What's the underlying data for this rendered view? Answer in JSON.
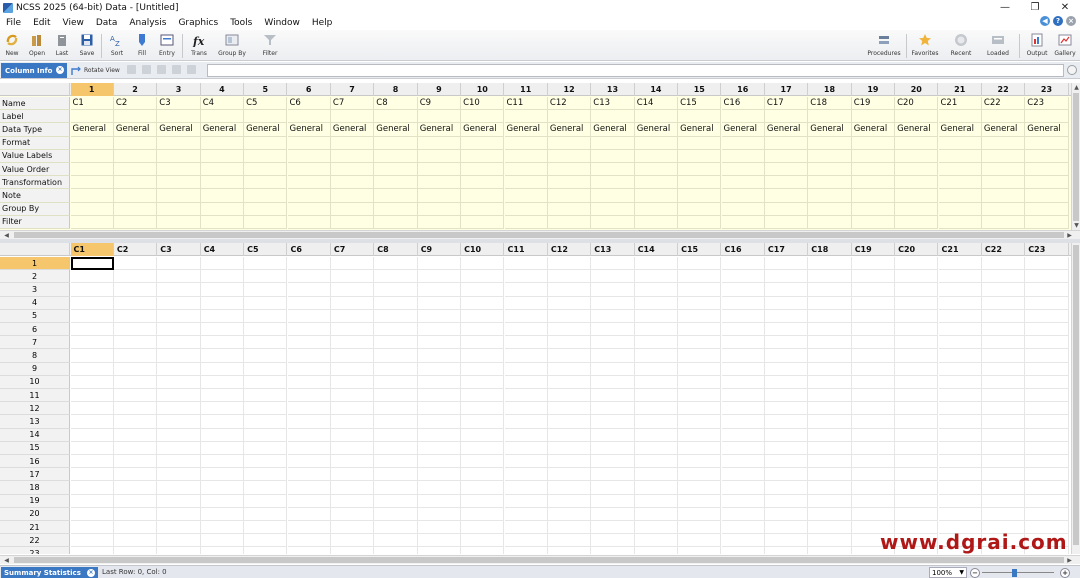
{
  "window": {
    "title": "NCSS 2025 (64-bit) Data - [Untitled]"
  },
  "menu": [
    "File",
    "Edit",
    "View",
    "Data",
    "Analysis",
    "Graphics",
    "Tools",
    "Window",
    "Help"
  ],
  "toolbar": {
    "left": [
      {
        "label": "New",
        "icon": "new-icon"
      },
      {
        "label": "Open",
        "icon": "open-icon"
      },
      {
        "label": "Last",
        "icon": "last-icon"
      },
      {
        "label": "Save",
        "icon": "save-icon"
      },
      {
        "label": "Sort",
        "icon": "sort-icon"
      },
      {
        "label": "Fill",
        "icon": "fill-icon"
      },
      {
        "label": "Entry",
        "icon": "entry-icon"
      },
      {
        "label": "Trans",
        "icon": "function-icon"
      },
      {
        "label": "Group By",
        "icon": "group-by-icon"
      },
      {
        "label": "Filter",
        "icon": "filter-icon"
      }
    ],
    "right": [
      {
        "label": "Procedures",
        "icon": "procedures-icon"
      },
      {
        "label": "Favorites",
        "icon": "star-icon"
      },
      {
        "label": "Recent",
        "icon": "recent-icon"
      },
      {
        "label": "Loaded",
        "icon": "loaded-icon"
      },
      {
        "label": "Output",
        "icon": "output-icon"
      },
      {
        "label": "Gallery",
        "icon": "gallery-icon"
      }
    ]
  },
  "tabs": {
    "active": "Column Info",
    "rotate_view": "Rotate View"
  },
  "column_info": {
    "col_numbers": [
      "1",
      "2",
      "3",
      "4",
      "5",
      "6",
      "7",
      "8",
      "9",
      "10",
      "11",
      "12",
      "13",
      "14",
      "15",
      "16",
      "17",
      "18",
      "19",
      "20",
      "21",
      "22",
      "23"
    ],
    "row_labels": [
      "Name",
      "Label",
      "Data Type",
      "Format",
      "Value Labels",
      "Value Order",
      "Transformation",
      "Note",
      "Group By",
      "Filter"
    ],
    "names": [
      "C1",
      "C2",
      "C3",
      "C4",
      "C5",
      "C6",
      "C7",
      "C8",
      "C9",
      "C10",
      "C11",
      "C12",
      "C13",
      "C14",
      "C15",
      "C16",
      "C17",
      "C18",
      "C19",
      "C20",
      "C21",
      "C22",
      "C23"
    ],
    "data_type": "General"
  },
  "data_grid": {
    "col_headers": [
      "C1",
      "C2",
      "C3",
      "C4",
      "C5",
      "C6",
      "C7",
      "C8",
      "C9",
      "C10",
      "C11",
      "C12",
      "C13",
      "C14",
      "C15",
      "C16",
      "C17",
      "C18",
      "C19",
      "C20",
      "C21",
      "C22",
      "C23"
    ],
    "row_numbers": [
      "1",
      "2",
      "3",
      "4",
      "5",
      "6",
      "7",
      "8",
      "9",
      "10",
      "11",
      "12",
      "13",
      "14",
      "15",
      "16",
      "17",
      "18",
      "19",
      "20",
      "21",
      "22",
      "23"
    ]
  },
  "status": {
    "tab": "Summary Statistics",
    "text": "Last Row: 0, Col: 0",
    "zoom": "100%"
  },
  "watermark": "www.dgrai.com",
  "colors": {
    "accent": "#3b78c4",
    "selected_header": "#f6c66c",
    "info_bg": "#ffffe4",
    "watermark": "#b01818"
  }
}
